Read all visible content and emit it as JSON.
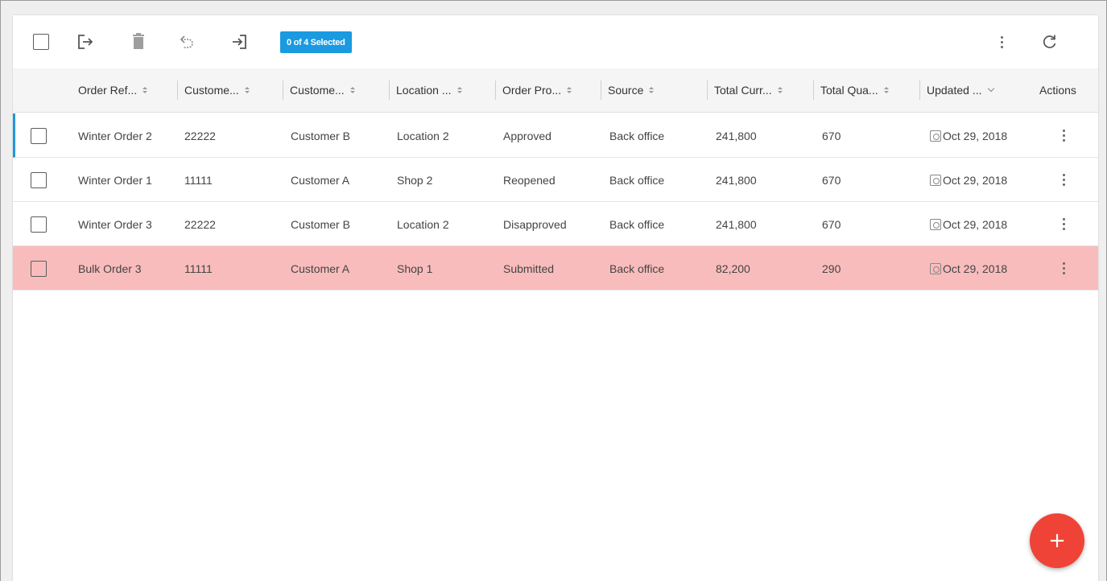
{
  "toolbar": {
    "selection_badge": "0 of 4 Selected",
    "icons": [
      "select-all-checkbox",
      "export-icon",
      "delete-icon",
      "undo-icon",
      "import-icon",
      "more-vert-icon",
      "refresh-icon"
    ]
  },
  "table": {
    "columns": [
      "Order Ref... ",
      "Custome... ",
      "Custome... ",
      "Location ... ",
      "Order Pro... ",
      "Source ",
      "Total Curr... ",
      "Total Qua... ",
      "Updated ... ",
      "Actions"
    ],
    "rows": [
      {
        "order_ref": "Winter Order 2",
        "customer_id": "22222",
        "customer_name": "Customer B",
        "location": "Location 2",
        "order_process": "Approved",
        "source": "Back office",
        "total_currency": "241,800",
        "total_quantity": "670",
        "updated": "Oct 29, 2018"
      },
      {
        "order_ref": "Winter Order 1",
        "customer_id": "11111",
        "customer_name": "Customer A",
        "location": "Shop 2",
        "order_process": "Reopened",
        "source": "Back office",
        "total_currency": "241,800",
        "total_quantity": "670",
        "updated": "Oct 29, 2018"
      },
      {
        "order_ref": "Winter Order 3",
        "customer_id": "22222",
        "customer_name": "Customer B",
        "location": "Location 2",
        "order_process": "Disapproved",
        "source": "Back office",
        "total_currency": "241,800",
        "total_quantity": "670",
        "updated": "Oct 29, 2018"
      },
      {
        "order_ref": "Bulk Order 3",
        "customer_id": "11111",
        "customer_name": "Customer A",
        "location": "Shop 1",
        "order_process": "Submitted",
        "source": "Back office",
        "total_currency": "82,200",
        "total_quantity": "290",
        "updated": "Oct 29, 2018"
      }
    ]
  },
  "fab": {
    "label": "+"
  },
  "colors": {
    "accent": "#1a9ae0",
    "highlight_row": "#f9bcbc",
    "fab": "#f04337"
  }
}
